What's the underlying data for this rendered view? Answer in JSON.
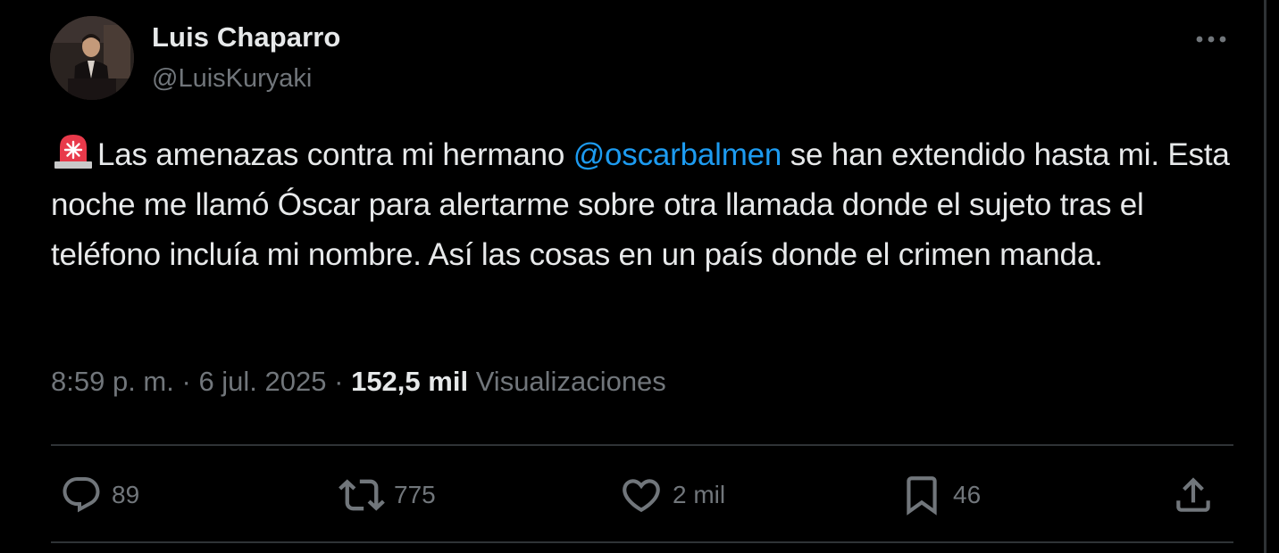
{
  "author": {
    "display_name": "Luis Chaparro",
    "handle": "@LuisKuryaki"
  },
  "tweet": {
    "text_before_mention": "Las amenazas contra mi hermano ",
    "mention": "@oscarbalmen",
    "text_after_mention": " se han extendido hasta mi. Esta noche me llamó Óscar para alertarme sobre otra llamada donde el sujeto tras el teléfono incluía mi nombre. Así las cosas en un país donde el crimen manda.",
    "leading_emoji": "rotating-light-icon"
  },
  "meta": {
    "time": "8:59 p. m.",
    "separator": "·",
    "date": "6 jul. 2025",
    "views_count": "152,5 mil",
    "views_label": "Visualizaciones"
  },
  "actions": {
    "replies": "89",
    "reposts": "775",
    "likes": "2 mil",
    "bookmarks": "46"
  },
  "colors": {
    "background": "#000000",
    "text": "#e7e9ea",
    "muted": "#71767b",
    "link": "#1d9bf0",
    "divider": "#2f3336"
  }
}
